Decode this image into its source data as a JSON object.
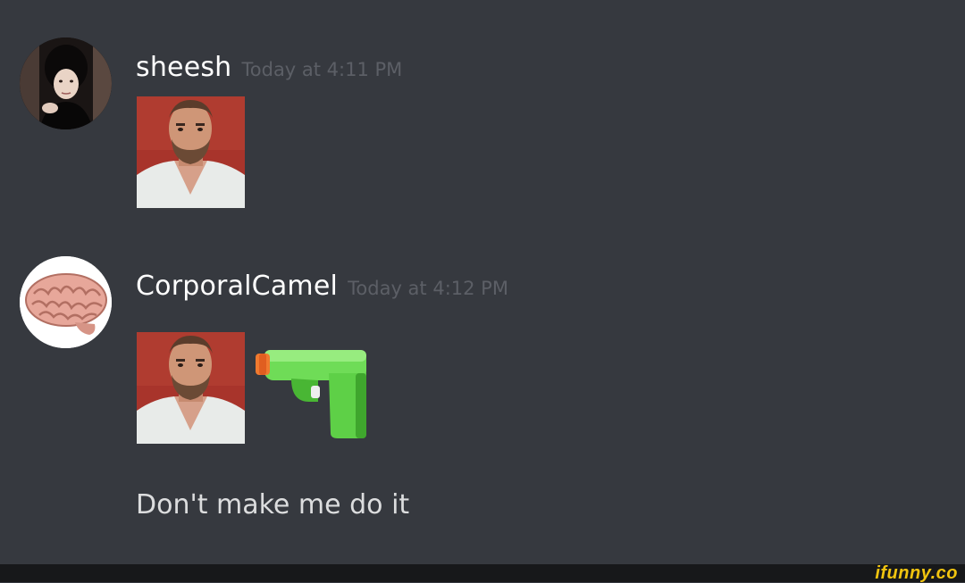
{
  "messages": [
    {
      "username": "sheesh",
      "timestamp": "Today at 4:11 PM",
      "avatar_icon": "woman-portrait-avatar-icon",
      "attachments": [
        "bearded-man-emoji"
      ]
    },
    {
      "username": "CorporalCamel",
      "timestamp": "Today at 4:12 PM",
      "avatar_icon": "brain-avatar-icon",
      "attachments": [
        "bearded-man-emoji",
        "water-pistol-emoji"
      ],
      "text": "Don't make me do it"
    }
  ],
  "watermark": "ifunny.co",
  "colors": {
    "background": "#36393f",
    "username": "#ffffff",
    "timestamp": "#5c5f66",
    "message_text": "#dcddde",
    "watermark": "#f1c40f"
  }
}
